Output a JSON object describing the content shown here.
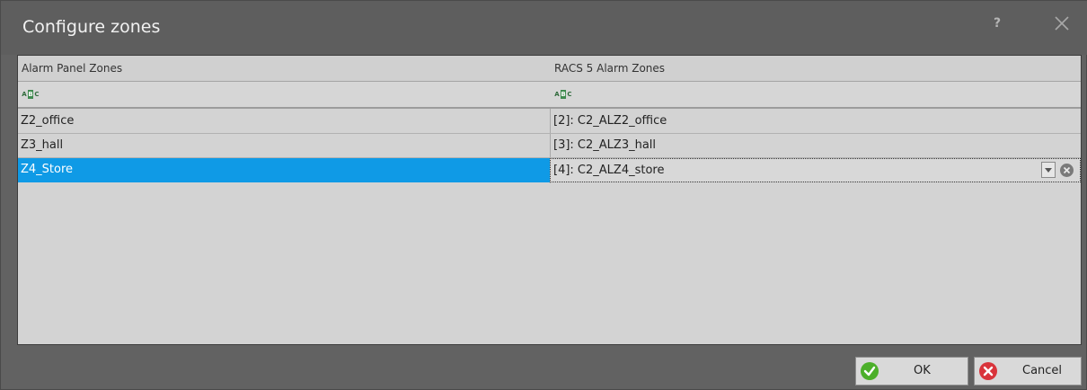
{
  "window": {
    "title": "Configure zones",
    "help_label": "?"
  },
  "grid": {
    "columns": [
      {
        "label": "Alarm Panel Zones"
      },
      {
        "label": "RACS 5 Alarm Zones"
      }
    ],
    "filter_icon": "abc-filter-icon",
    "filter_icon_letters": [
      "A",
      "B",
      "C"
    ],
    "rows": [
      {
        "panel_zone": "Z2_office",
        "racs_zone": "[2]: C2_ALZ2_office",
        "selected": false
      },
      {
        "panel_zone": "Z3_hall",
        "racs_zone": "[3]: C2_ALZ3_hall",
        "selected": false
      },
      {
        "panel_zone": "Z4_Store",
        "racs_zone": "[4]: C2_ALZ4_store",
        "selected": true
      }
    ]
  },
  "buttons": {
    "ok_label": "OK",
    "cancel_label": "Cancel"
  },
  "colors": {
    "selection": "#0f9ae6",
    "ok_icon": "#4caf2a",
    "cancel_icon": "#d9343b"
  }
}
